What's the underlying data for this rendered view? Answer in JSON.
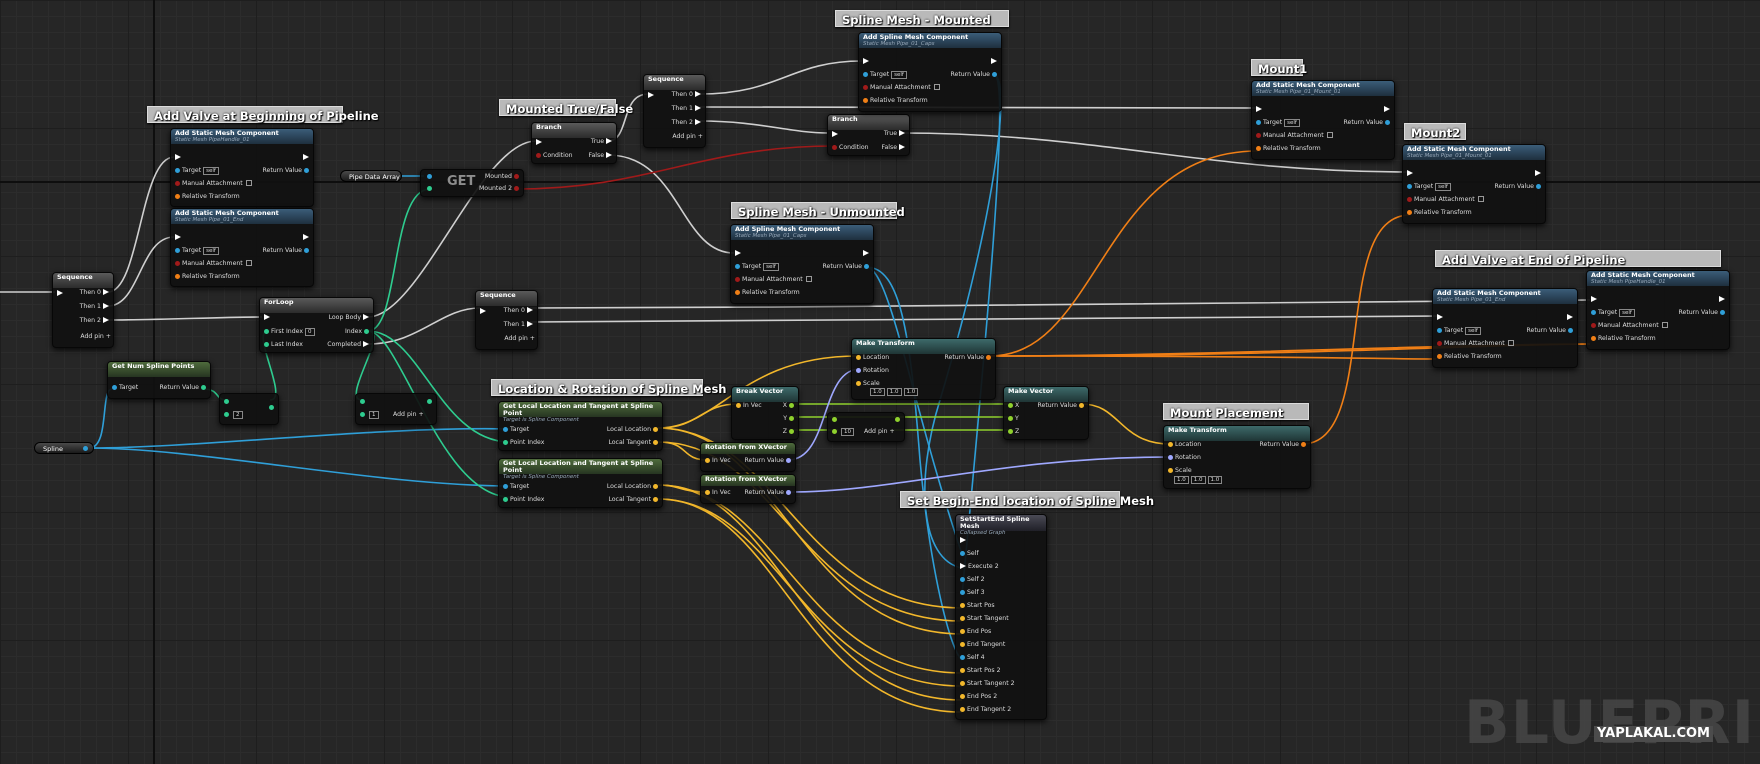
{
  "comments": {
    "valve_begin": "Add Valve at Beginning of Pipeline",
    "mounted_tf": "Mounted True/False",
    "spline_mounted": "Spline Mesh - Mounted",
    "spline_unmounted": "Spline Mesh - Unmounted",
    "mount1": "Mount1",
    "mount2": "Mount2",
    "valve_end": "Add Valve at End of Pipeline",
    "loc_rot": "Location & Rotation of Spline Mesh",
    "mount_place": "Mount Placement",
    "begin_end": "Set Begin-End location of Spline Mesh"
  },
  "labels": {
    "add_static": "Add Static Mesh Component",
    "add_spline": "Add Spline Mesh Component",
    "target": "Target",
    "self": "self",
    "return_value": "Return Value",
    "manual": "Manual Attachment",
    "rel_transform": "Relative Transform",
    "sequence": "Sequence",
    "then0": "Then 0",
    "then1": "Then 1",
    "then2": "Then 2",
    "add_pin": "Add pin",
    "branch": "Branch",
    "condition": "Condition",
    "true": "True",
    "false": "False",
    "for_loop": "ForLoop",
    "loop_body": "Loop Body",
    "first_index": "First Index",
    "last_index": "Last Index",
    "index": "Index",
    "completed": "Completed",
    "get": "GET",
    "mounted": "Mounted",
    "mounted2": "Mounted 2",
    "pipe_data_array": "Pipe Data Array",
    "get_num": "Get Num Spline Points",
    "spline": "Spline",
    "get_local": "Get Local Location and Tangent at Spline Point",
    "target_is_spline": "Target is Spline Component",
    "point_index": "Point Index",
    "local_location": "Local Location",
    "local_tangent": "Local Tangent",
    "break_vector": "Break Vector",
    "in_vec": "In Vec",
    "x": "X",
    "y": "Y",
    "z": "Z",
    "make_vector": "Make Vector",
    "make_transform": "Make Transform",
    "location": "Location",
    "rotation": "Rotation",
    "scale": "Scale",
    "rot_from_x": "Rotation from XVector",
    "set_start_end": "SetStartEnd Spline Mesh",
    "collapsed_graph": "Collapsed Graph",
    "self_pin": "Self",
    "execute2": "Execute 2",
    "self2": "Self 2",
    "self3": "Self 3",
    "start_pos": "Start Pos",
    "start_tangent": "Start Tangent",
    "end_pos": "End Pos",
    "end_tangent": "End Tangent",
    "self4": "Self 4",
    "start_pos2": "Start Pos 2",
    "start_tangent2": "Start Tangent 2",
    "end_pos2": "End Pos 2",
    "end_tangent2": "End Tangent 2",
    "scale_val": "1.0",
    "val_10": "10",
    "val_2": "2",
    "val_0": "0",
    "val_1": "1"
  },
  "meshes": {
    "valve_handle": "Static Mesh PipeHandle_01",
    "pipe_end": "Static Mesh Pipe_01_End",
    "pipe_caps": "Static Mesh Pipe_01_Caps",
    "mount01": "Static Mesh Pipe_01_Mount_01",
    "mount02": "Static Mesh Pipe_01_Mount_01"
  },
  "watermark": "BLUEPRINT",
  "site": "YAPLAKAL.COM",
  "colors": {
    "exec": "#ffffff",
    "object": "#2f9fd8",
    "bool": "#a01a1a",
    "int": "#2ecc8f",
    "vector": "#f2b72b",
    "rotator": "#9fa8ff",
    "transform": "#f07f16",
    "float": "#8fd12d"
  }
}
